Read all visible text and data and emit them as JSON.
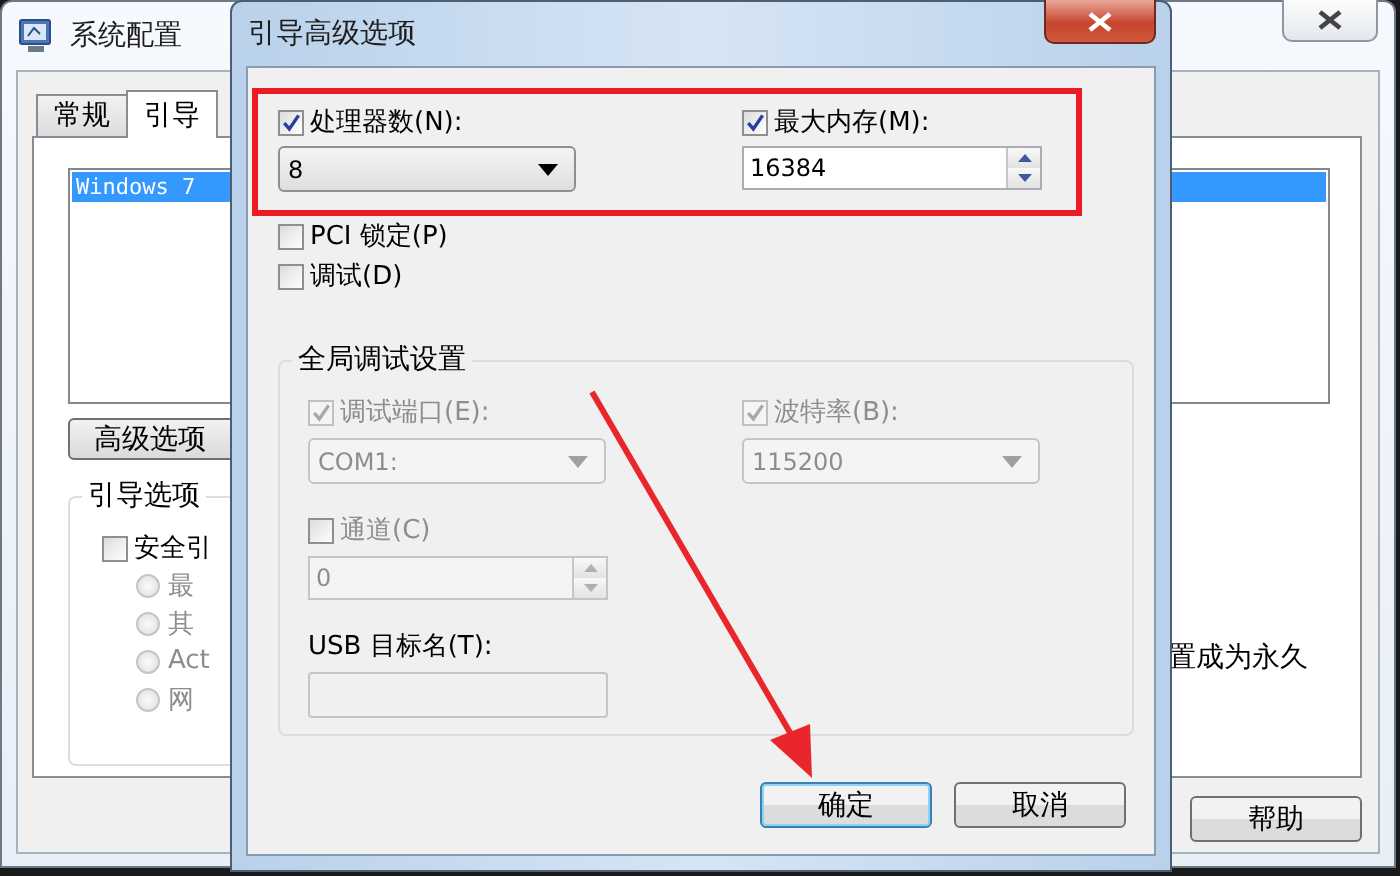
{
  "background_window": {
    "title": "系统配置",
    "tabs": [
      {
        "label": "常规",
        "selected": false
      },
      {
        "label": "引导",
        "selected": true
      }
    ],
    "boot_list": [
      {
        "label": "Windows 7",
        "selected": true
      }
    ],
    "advanced_button": "高级选项",
    "boot_options": {
      "title": "引导选项",
      "safe_boot": {
        "label": "安全引",
        "checked": false
      },
      "radios_disabled": true,
      "radios": [
        {
          "label": "最",
          "selected": false
        },
        {
          "label": "其",
          "selected": false
        },
        {
          "label": "Act",
          "selected": false
        },
        {
          "label": "网",
          "selected": false
        }
      ]
    },
    "partial_text": "置成为永久",
    "help_button": "帮助"
  },
  "dialog": {
    "title": "引导高级选项",
    "processors": {
      "label": "处理器数(N):",
      "checked": true,
      "value": "8"
    },
    "max_memory": {
      "label": "最大内存(M):",
      "checked": true,
      "value": "16384"
    },
    "options": [
      {
        "label": "PCI 锁定(P)",
        "checked": false
      },
      {
        "label": "调试(D)",
        "checked": false
      }
    ],
    "debug_settings": {
      "title": "全局调试设置",
      "disabled": true,
      "debug_port": {
        "label": "调试端口(E):",
        "checked": true,
        "value": "COM1:"
      },
      "baud_rate": {
        "label": "波特率(B):",
        "checked": true,
        "value": "115200"
      },
      "channel": {
        "label": "通道(C)",
        "checked": false,
        "value": "0"
      },
      "usb_target": {
        "label": "USB 目标名(T):"
      }
    },
    "buttons": [
      {
        "label": "确定",
        "focused": true
      },
      {
        "label": "取消",
        "focused": false
      }
    ]
  }
}
